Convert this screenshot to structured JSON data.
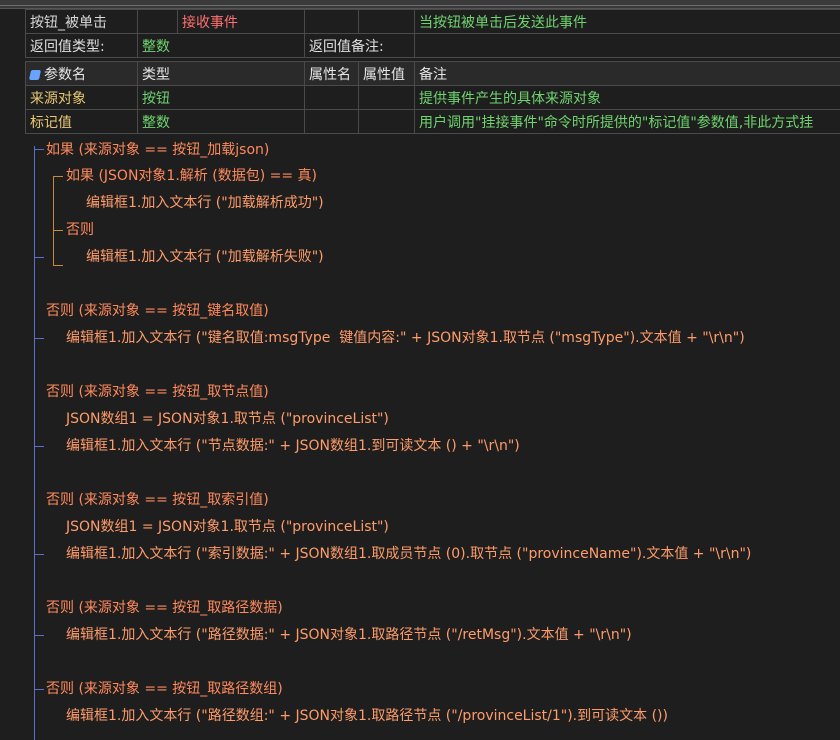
{
  "header": {
    "row1": {
      "name": "按钮_被单击",
      "event": "接收事件",
      "desc": "当按钮被单击后发送此事件"
    },
    "row2": {
      "ret_label": "返回值类型:",
      "ret_type": "整数",
      "ret_note_label": "返回值备注:"
    },
    "columns": {
      "param": "参数名",
      "type": "类型",
      "attr_name": "属性名",
      "attr_val": "属性值",
      "note": "备注"
    },
    "params": [
      {
        "name": "来源对象",
        "type": "按钮",
        "note": "提供事件产生的具体来源对象"
      },
      {
        "name": "标记值",
        "type": "整数",
        "note": "用户调用\"挂接事件\"命令时所提供的\"标记值\"参数值,非此方式挂"
      }
    ]
  },
  "code": [
    "如果 (来源对象 == 按钮_加载json)",
    "如果 (JSON对象1.解析 (数据包) == 真)",
    "编辑框1.加入文本行 (\"加载解析成功\")",
    "否则",
    "编辑框1.加入文本行 (\"加载解析失败\")",
    "否则 (来源对象 == 按钮_键名取值)",
    "编辑框1.加入文本行 (\"键名取值:msgType  键值内容:\" + JSON对象1.取节点 (\"msgType\").文本值 + \"\\r\\n\")",
    "否则 (来源对象 == 按钮_取节点值)",
    "JSON数组1 = JSON对象1.取节点 (\"provinceList\")",
    "编辑框1.加入文本行 (\"节点数据:\" + JSON数组1.到可读文本 () + \"\\r\\n\")",
    "否则 (来源对象 == 按钮_取索引值)",
    "JSON数组1 = JSON对象1.取节点 (\"provinceList\")",
    "编辑框1.加入文本行 (\"索引数据:\" + JSON数组1.取成员节点 (0).取节点 (\"provinceName\").文本值 + \"\\r\\n\")",
    "否则 (来源对象 == 按钮_取路径数据)",
    "编辑框1.加入文本行 (\"路径数据:\" + JSON对象1.取路径节点 (\"/retMsg\").文本值 + \"\\r\\n\")",
    "否则 (来源对象 == 按钮_取路径数组)",
    "编辑框1.加入文本行 (\"路径数组:\" + JSON对象1.取路径节点 (\"/provinceList/1\").到可读文本 ())"
  ]
}
